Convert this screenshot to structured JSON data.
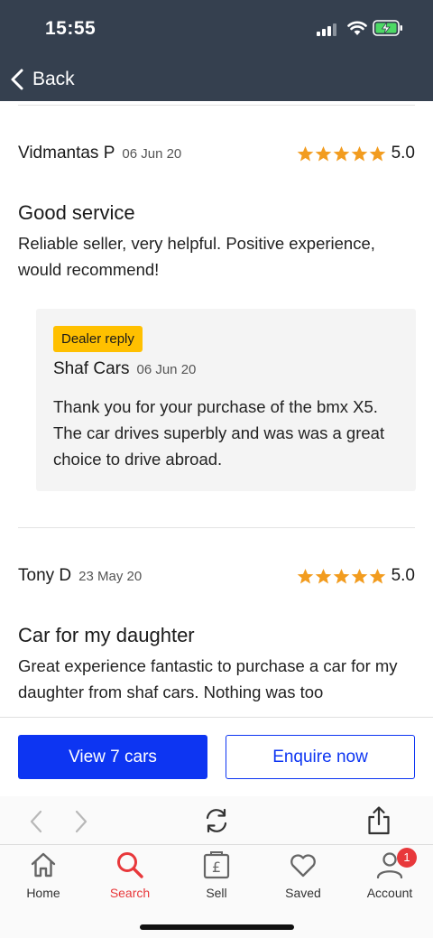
{
  "status_bar": {
    "time": "15:55"
  },
  "nav": {
    "back_label": "Back"
  },
  "reviews": [
    {
      "reviewer": "Vidmantas P",
      "date": "06 Jun 20",
      "rating": 5.0,
      "rating_text": "5.0",
      "title": "Good service",
      "body": "Reliable seller, very helpful. Positive experience, would recommend!",
      "reply": {
        "badge": "Dealer reply",
        "author": "Shaf Cars",
        "date": "06 Jun 20",
        "text": "Thank you for your purchase of the bmx X5. The car drives superbly and was was a great choice to drive abroad."
      }
    },
    {
      "reviewer": "Tony D",
      "date": "23 May 20",
      "rating": 5.0,
      "rating_text": "5.0",
      "title": "Car for my daughter",
      "body": "Great experience fantastic to purchase a car for my daughter from shaf cars. Nothing was too"
    }
  ],
  "actions": {
    "primary_label": "View 7 cars",
    "secondary_label": "Enquire now"
  },
  "tabs": [
    {
      "label": "Home",
      "icon": "home-icon",
      "active": false
    },
    {
      "label": "Search",
      "icon": "search-icon",
      "active": true
    },
    {
      "label": "Sell",
      "icon": "pound-tag-icon",
      "active": false
    },
    {
      "label": "Saved",
      "icon": "heart-icon",
      "active": false
    },
    {
      "label": "Account",
      "icon": "account-icon",
      "active": false,
      "badge": "1"
    }
  ],
  "colors": {
    "header_bg": "#35404f",
    "primary_blue": "#0d35f2",
    "star_orange": "#f29c1f",
    "badge_yellow": "#ffc000",
    "active_red": "#e8383b"
  }
}
